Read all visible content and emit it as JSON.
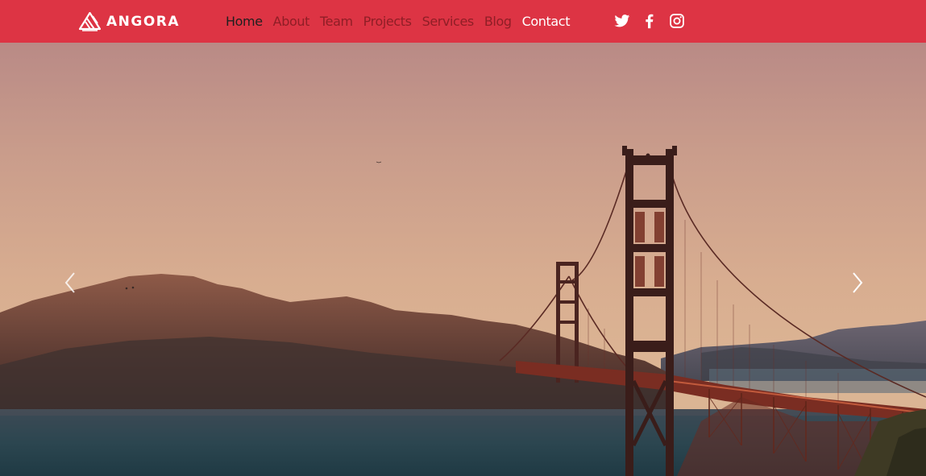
{
  "brand": {
    "name": "ANGORA",
    "logo_icon": "angora-logo-icon"
  },
  "nav": {
    "items": [
      {
        "label": "Home",
        "state": "active"
      },
      {
        "label": "About",
        "state": "normal"
      },
      {
        "label": "Team",
        "state": "normal"
      },
      {
        "label": "Projects",
        "state": "normal"
      },
      {
        "label": "Services",
        "state": "normal"
      },
      {
        "label": "Blog",
        "state": "normal"
      },
      {
        "label": "Contact",
        "state": "highlight"
      }
    ]
  },
  "social": [
    {
      "icon": "twitter-icon"
    },
    {
      "icon": "facebook-icon"
    },
    {
      "icon": "instagram-icon"
    }
  ],
  "hero": {
    "image": "golden-gate-bridge-sunset-photo",
    "prev_icon": "chevron-left-icon",
    "next_icon": "chevron-right-icon"
  },
  "colors": {
    "navbar": "#dd3444",
    "nav_link": "#8f1e26",
    "nav_active": "#1f1f1f",
    "nav_contact": "#ffffff"
  }
}
